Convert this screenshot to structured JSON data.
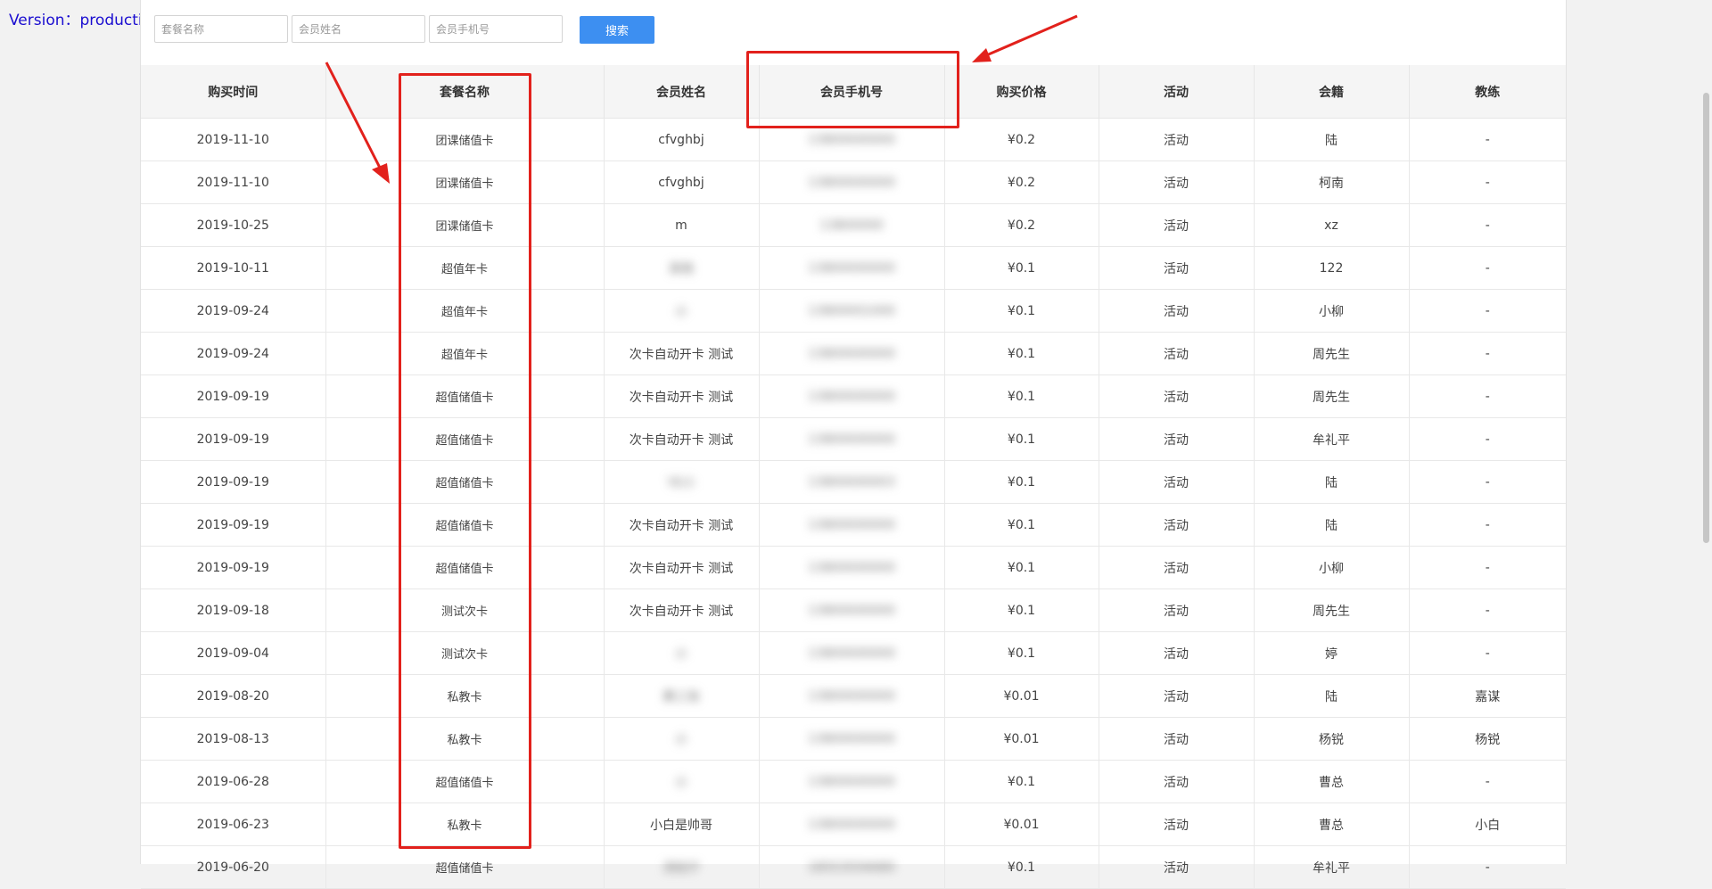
{
  "version_label": "Version：production",
  "search": {
    "package_placeholder": "套餐名称",
    "member_name_placeholder": "会员姓名",
    "member_phone_placeholder": "会员手机号",
    "button_label": "搜索"
  },
  "table": {
    "headers": [
      "购买时间",
      "套餐名称",
      "会员姓名",
      "会员手机号",
      "购买价格",
      "活动",
      "会籍",
      "教练"
    ],
    "rows": [
      [
        "2019-11-10",
        "团课储值卡",
        "cfvghbj",
        "13800000000",
        "¥0.2",
        "活动",
        "陆",
        "-"
      ],
      [
        "2019-11-10",
        "团课储值卡",
        "cfvghbj",
        "13800000000",
        "¥0.2",
        "活动",
        "柯南",
        "-"
      ],
      [
        "2019-10-25",
        "团课储值卡",
        "m",
        "13800000",
        "¥0.2",
        "活动",
        "xz",
        "-"
      ],
      [
        "2019-10-11",
        "超值年卡",
        "吴晓",
        "13800000000",
        "¥0.1",
        "活动",
        "122",
        "-"
      ],
      [
        "2019-09-24",
        "超值年卡",
        "小",
        "13800001000",
        "¥0.1",
        "活动",
        "小柳",
        "-"
      ],
      [
        "2019-09-24",
        "超值年卡",
        "次卡自动开卡 测试",
        "13800000000",
        "¥0.1",
        "活动",
        "周先生",
        "-"
      ],
      [
        "2019-09-19",
        "超值储值卡",
        "次卡自动开卡 测试",
        "13800000000",
        "¥0.1",
        "活动",
        "周先生",
        "-"
      ],
      [
        "2019-09-19",
        "超值储值卡",
        "次卡自动开卡 测试",
        "13800000000",
        "¥0.1",
        "活动",
        "牟礼平",
        "-"
      ],
      [
        "2019-09-19",
        "超值储值卡",
        "YE小",
        "13800000003",
        "¥0.1",
        "活动",
        "陆",
        "-"
      ],
      [
        "2019-09-19",
        "超值储值卡",
        "次卡自动开卡 测试",
        "13800000000",
        "¥0.1",
        "活动",
        "陆",
        "-"
      ],
      [
        "2019-09-19",
        "超值储值卡",
        "次卡自动开卡 测试",
        "13800000000",
        "¥0.1",
        "活动",
        "小柳",
        "-"
      ],
      [
        "2019-09-18",
        "测试次卡",
        "次卡自动开卡 测试",
        "13800000000",
        "¥0.1",
        "活动",
        "周先生",
        "-"
      ],
      [
        "2019-09-04",
        "测试次卡",
        "小",
        "13800000000",
        "¥0.1",
        "活动",
        "婷",
        "-"
      ],
      [
        "2019-08-20",
        "私教卡",
        "黄三张",
        "13800000000",
        "¥0.01",
        "活动",
        "陆",
        "嘉谋"
      ],
      [
        "2019-08-13",
        "私教卡",
        "小",
        "13800000000",
        "¥0.01",
        "活动",
        "杨锐",
        "杨锐"
      ],
      [
        "2019-06-28",
        "超值储值卡",
        "小",
        "13800000000",
        "¥0.1",
        "活动",
        "曹总",
        "-"
      ],
      [
        "2019-06-23",
        "私教卡",
        "小白是帅哥",
        "13800000000",
        "¥0.01",
        "活动",
        "曹总",
        "小白"
      ],
      [
        "2019-06-20",
        "超值储值卡",
        "汤钰宁",
        "18553556680",
        "¥0.1",
        "活动",
        "牟礼平",
        "-"
      ]
    ]
  },
  "colors": {
    "accent": "#3d8ff1",
    "annotation": "#e2211c",
    "version_text": "#1a0dd0"
  }
}
